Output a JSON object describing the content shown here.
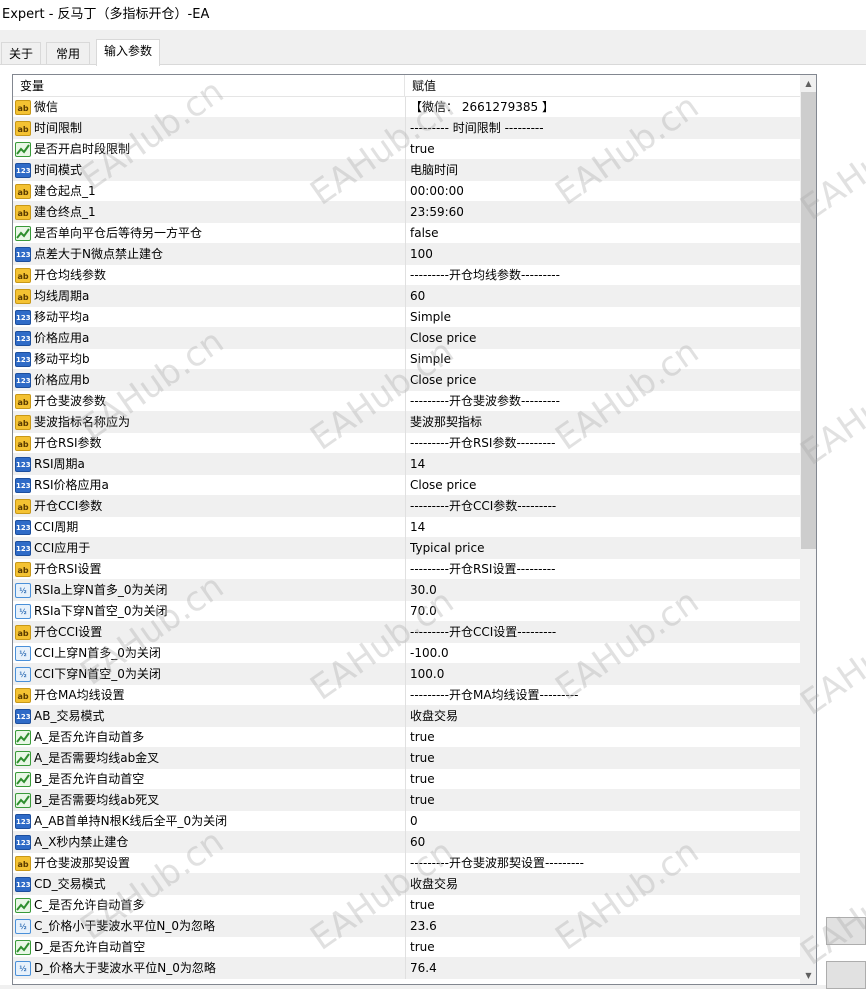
{
  "window": {
    "title": "Expert - 反马丁（多指标开仓）-EA"
  },
  "tabs": [
    {
      "label": "关于",
      "active": false
    },
    {
      "label": "常用",
      "active": false
    },
    {
      "label": "输入参数",
      "active": true
    }
  ],
  "table": {
    "headers": {
      "variable": "变量",
      "value": "赋值"
    },
    "rows": [
      {
        "icon": "ab-string-icon",
        "type": "ab",
        "name": "微信",
        "value": "【微信： 2661279385 】"
      },
      {
        "icon": "ab-string-icon",
        "type": "ab",
        "name": "时间限制",
        "value": "--------- 时间限制 ---------"
      },
      {
        "icon": "bool-icon",
        "type": "b",
        "name": "是否开启时段限制",
        "value": "true"
      },
      {
        "icon": "enum-icon",
        "type": "n",
        "name": "时间模式",
        "value": "电脑时间"
      },
      {
        "icon": "ab-string-icon",
        "type": "ab",
        "name": "建仓起点_1",
        "value": "00:00:00"
      },
      {
        "icon": "ab-string-icon",
        "type": "ab",
        "name": "建仓终点_1",
        "value": "23:59:60"
      },
      {
        "icon": "bool-icon",
        "type": "b",
        "name": "是否单向平仓后等待另一方平仓",
        "value": "false"
      },
      {
        "icon": "int-icon",
        "type": "n",
        "name": "点差大于N微点禁止建仓",
        "value": "100"
      },
      {
        "icon": "ab-string-icon",
        "type": "ab",
        "name": "开仓均线参数",
        "value": "---------开仓均线参数---------"
      },
      {
        "icon": "ab-string-icon",
        "type": "ab",
        "name": "均线周期a",
        "value": "60"
      },
      {
        "icon": "enum-icon",
        "type": "n",
        "name": "移动平均a",
        "value": "Simple"
      },
      {
        "icon": "enum-icon",
        "type": "n",
        "name": "价格应用a",
        "value": "Close price"
      },
      {
        "icon": "enum-icon",
        "type": "n",
        "name": "移动平均b",
        "value": "Simple"
      },
      {
        "icon": "enum-icon",
        "type": "n",
        "name": "价格应用b",
        "value": "Close price"
      },
      {
        "icon": "ab-string-icon",
        "type": "ab",
        "name": "开仓斐波参数",
        "value": "---------开仓斐波参数---------"
      },
      {
        "icon": "ab-string-icon",
        "type": "ab",
        "name": "斐波指标名称应为",
        "value": "斐波那契指标"
      },
      {
        "icon": "ab-string-icon",
        "type": "ab",
        "name": "开仓RSI参数",
        "value": "---------开仓RSI参数---------"
      },
      {
        "icon": "int-icon",
        "type": "n",
        "name": "RSI周期a",
        "value": "14"
      },
      {
        "icon": "enum-icon",
        "type": "n",
        "name": "RSI价格应用a",
        "value": "Close price"
      },
      {
        "icon": "ab-string-icon",
        "type": "ab",
        "name": "开仓CCI参数",
        "value": "---------开仓CCI参数---------"
      },
      {
        "icon": "int-icon",
        "type": "n",
        "name": "CCI周期",
        "value": "14"
      },
      {
        "icon": "enum-icon",
        "type": "n",
        "name": "CCI应用于",
        "value": "Typical price"
      },
      {
        "icon": "ab-string-icon",
        "type": "ab",
        "name": "开仓RSI设置",
        "value": "---------开仓RSI设置---------"
      },
      {
        "icon": "float-icon",
        "type": "f",
        "name": "RSIa上穿N首多_0为关闭",
        "value": "30.0"
      },
      {
        "icon": "float-icon",
        "type": "f",
        "name": "RSIa下穿N首空_0为关闭",
        "value": "70.0"
      },
      {
        "icon": "ab-string-icon",
        "type": "ab",
        "name": "开仓CCI设置",
        "value": "---------开仓CCI设置---------"
      },
      {
        "icon": "float-icon",
        "type": "f",
        "name": "CCI上穿N首多_0为关闭",
        "value": "-100.0"
      },
      {
        "icon": "float-icon",
        "type": "f",
        "name": "CCI下穿N首空_0为关闭",
        "value": "100.0"
      },
      {
        "icon": "ab-string-icon",
        "type": "ab",
        "name": "开仓MA均线设置",
        "value": "---------开仓MA均线设置---------"
      },
      {
        "icon": "enum-icon",
        "type": "n",
        "name": "AB_交易模式",
        "value": "收盘交易"
      },
      {
        "icon": "bool-icon",
        "type": "b",
        "name": "A_是否允许自动首多",
        "value": "true"
      },
      {
        "icon": "bool-icon",
        "type": "b",
        "name": "A_是否需要均线ab金叉",
        "value": "true"
      },
      {
        "icon": "bool-icon",
        "type": "b",
        "name": "B_是否允许自动首空",
        "value": "true"
      },
      {
        "icon": "bool-icon",
        "type": "b",
        "name": "B_是否需要均线ab死叉",
        "value": "true"
      },
      {
        "icon": "int-icon",
        "type": "n",
        "name": "A_AB首单持N根K线后全平_0为关闭",
        "value": "0"
      },
      {
        "icon": "int-icon",
        "type": "n",
        "name": "A_X秒内禁止建仓",
        "value": "60"
      },
      {
        "icon": "ab-string-icon",
        "type": "ab",
        "name": "开仓斐波那契设置",
        "value": "---------开仓斐波那契设置---------"
      },
      {
        "icon": "enum-icon",
        "type": "n",
        "name": "CD_交易模式",
        "value": "收盘交易"
      },
      {
        "icon": "bool-icon",
        "type": "b",
        "name": "C_是否允许自动首多",
        "value": "true"
      },
      {
        "icon": "float-icon",
        "type": "f",
        "name": "C_价格小于斐波水平位N_0为忽略",
        "value": "23.6"
      },
      {
        "icon": "bool-icon",
        "type": "b",
        "name": "D_是否允许自动首空",
        "value": "true"
      },
      {
        "icon": "float-icon",
        "type": "f",
        "name": "D_价格大于斐波水平位N_0为忽略",
        "value": "76.4"
      }
    ]
  },
  "icon_labels": {
    "ab": "ab",
    "n": "123",
    "f": "½"
  },
  "watermark": {
    "text": "EAHub.cn"
  },
  "colors": {
    "alt_row": "#f0f0f0",
    "string_icon": "#f4c232",
    "int_icon": "#2f6bc7",
    "bool_icon": "#3a9a3a"
  }
}
